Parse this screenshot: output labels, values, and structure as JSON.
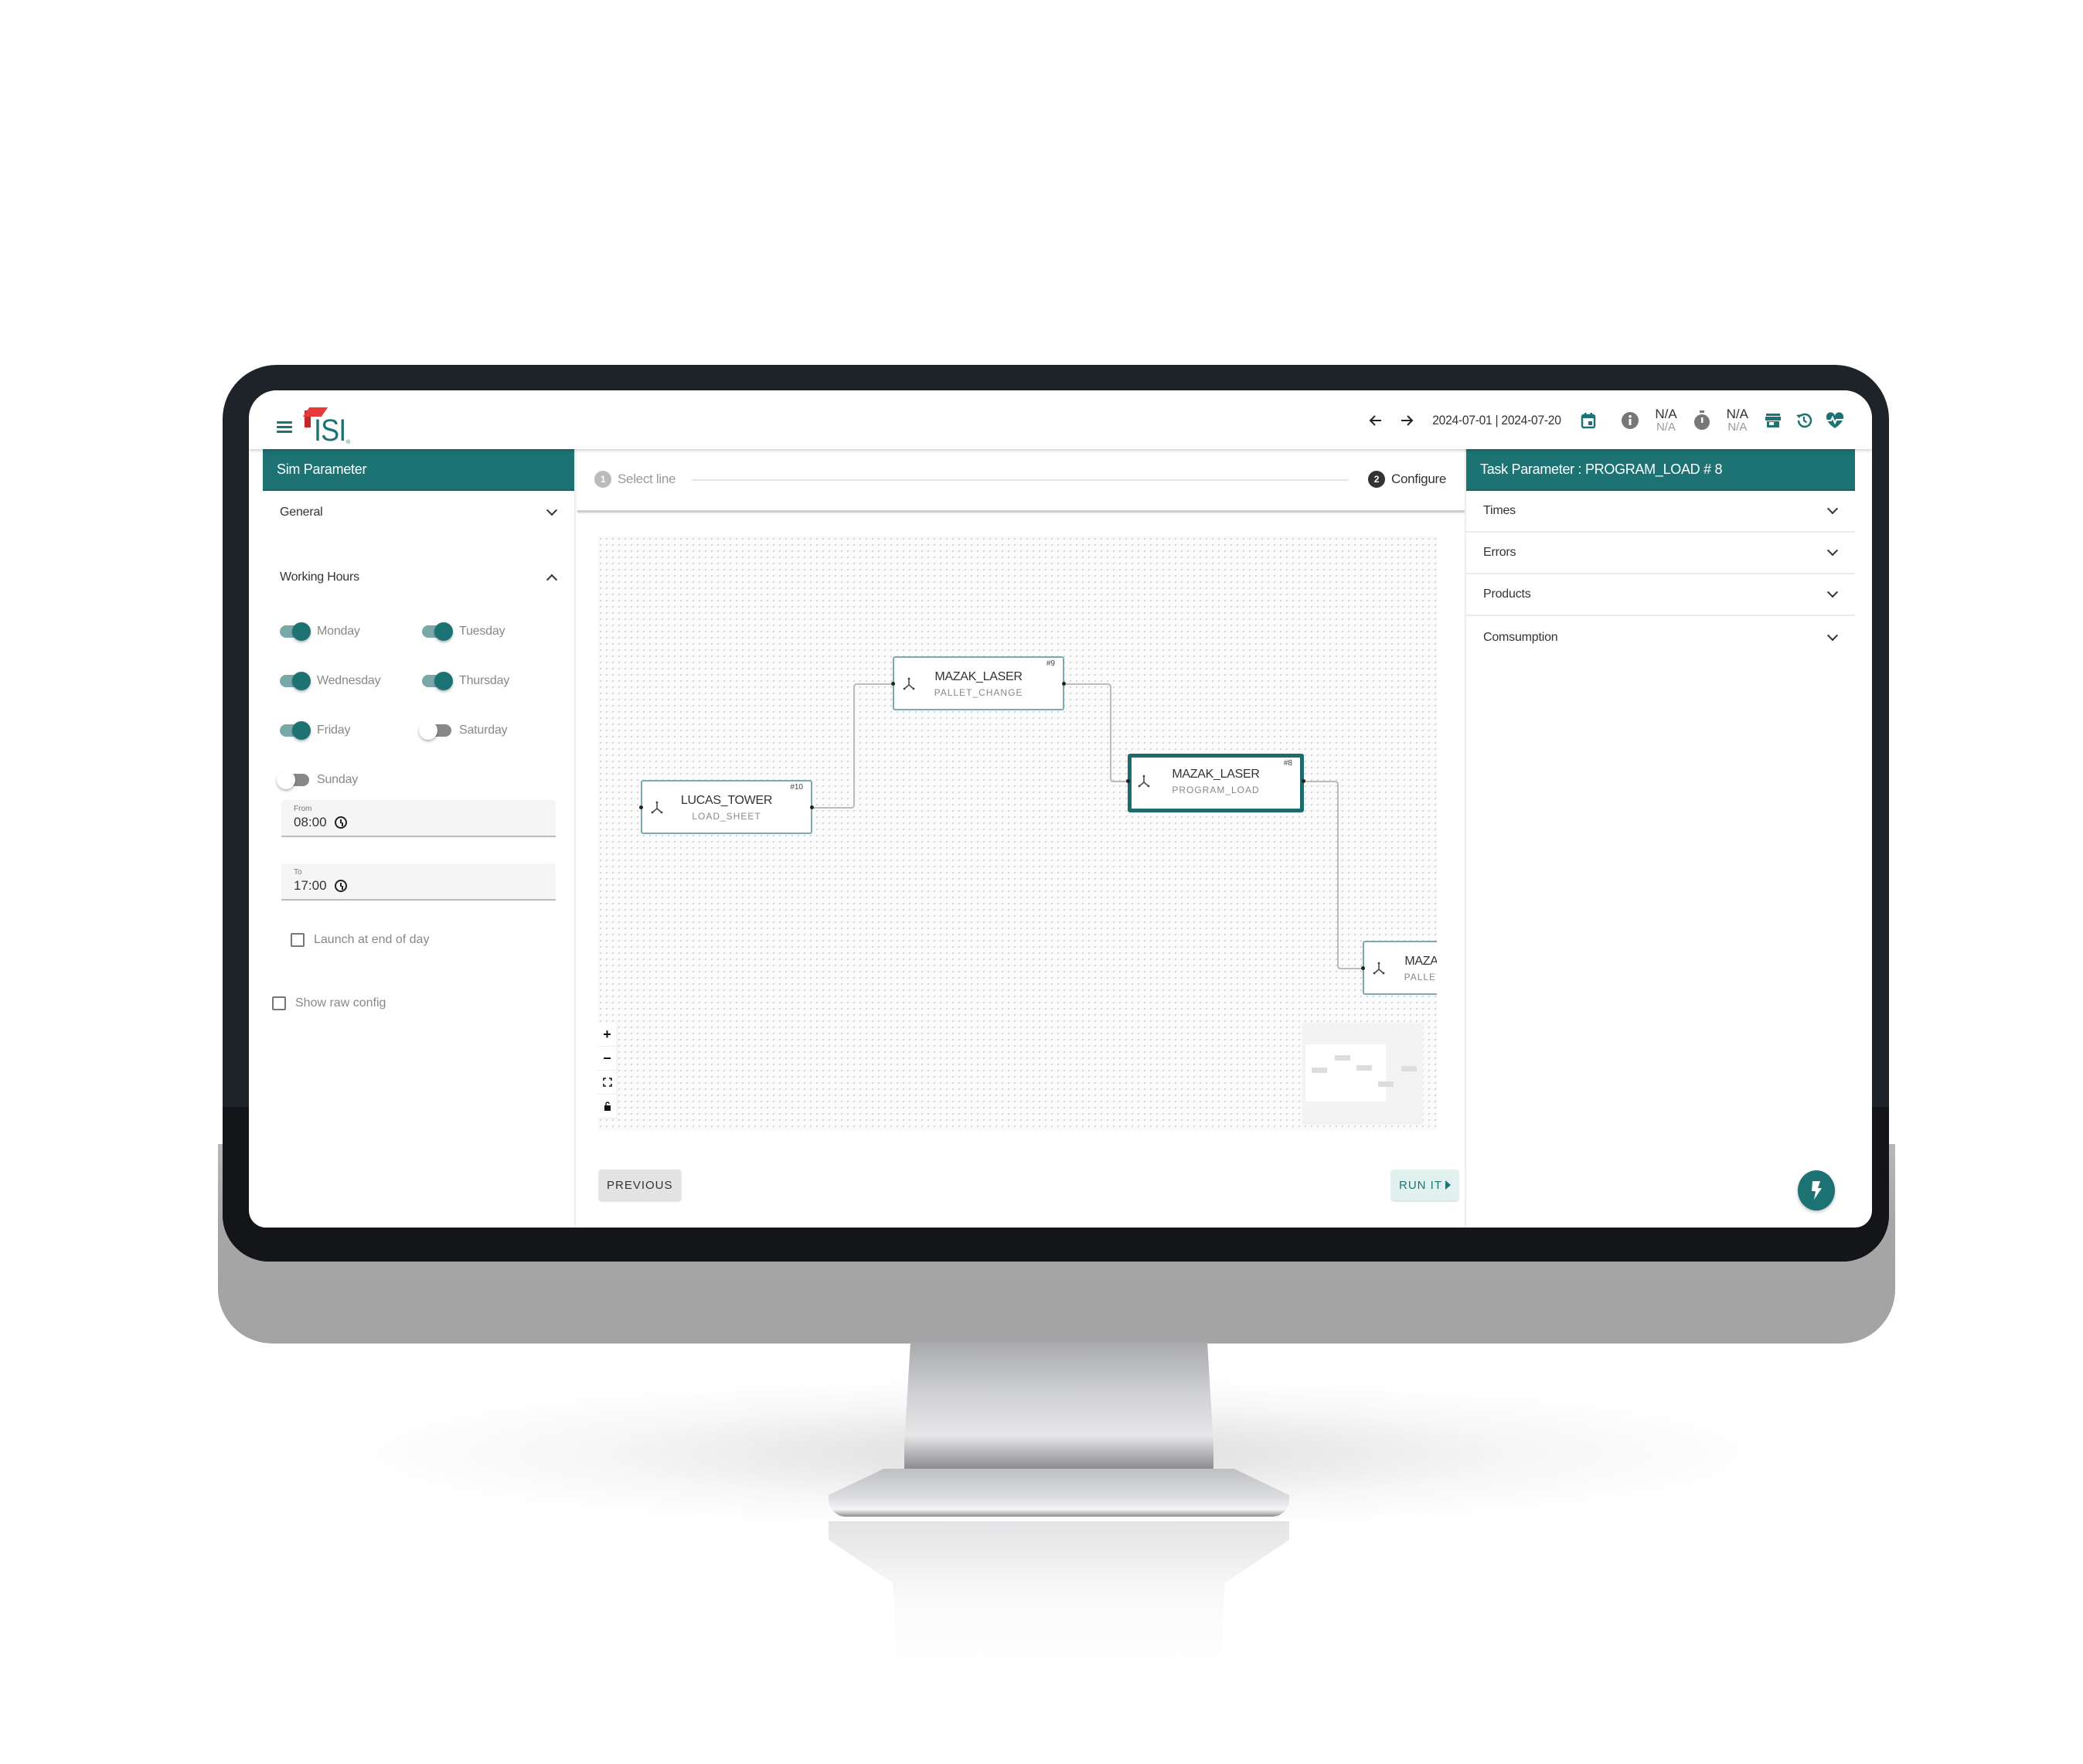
{
  "app": {
    "logo_text": "ISI",
    "logo_reg": "®",
    "brand_color": "#1d7373",
    "logo_accent_color": "#e03030"
  },
  "appbar": {
    "date_range": "2024-07-01 | 2024-07-20",
    "icons": [
      "menu-icon",
      "back-arrow-icon",
      "forward-arrow-icon",
      "calendar-icon",
      "info-icon",
      "stopwatch-icon",
      "store-icon",
      "history-icon",
      "heart-pulse-icon"
    ],
    "stats": [
      {
        "value": "N/A",
        "sub": "N/A"
      },
      {
        "value": "N/A",
        "sub": "N/A"
      }
    ]
  },
  "left_panel": {
    "title": "Sim Parameter",
    "sections": [
      {
        "label": "General",
        "expanded": false
      },
      {
        "label": "Working Hours",
        "expanded": true
      }
    ],
    "days": [
      {
        "label": "Monday",
        "on": true
      },
      {
        "label": "Tuesday",
        "on": true
      },
      {
        "label": "Wednesday",
        "on": true
      },
      {
        "label": "Thursday",
        "on": true
      },
      {
        "label": "Friday",
        "on": true
      },
      {
        "label": "Saturday",
        "on": false
      },
      {
        "label": "Sunday",
        "on": false
      }
    ],
    "from": {
      "label": "From",
      "value": "08:00"
    },
    "to": {
      "label": "To",
      "value": "17:00"
    },
    "launch_end_of_day": {
      "label": "Launch at end of day",
      "checked": false
    },
    "show_raw_config": {
      "label": "Show raw config",
      "checked": false
    }
  },
  "center": {
    "steps": [
      {
        "number": "1",
        "label": "Select line",
        "active": false
      },
      {
        "number": "2",
        "label": "Configure",
        "active": true
      }
    ],
    "nodes": [
      {
        "id": "#10",
        "title": "LUCAS_TOWER",
        "subtitle": "LOAD_SHEET",
        "selected": false
      },
      {
        "id": "#9",
        "title": "MAZAK_LASER",
        "subtitle": "PALLET_CHANGE",
        "selected": false
      },
      {
        "id": "#8",
        "title": "MAZAK_LASER",
        "subtitle": "PROGRAM_LOAD",
        "selected": true
      },
      {
        "id": "",
        "title": "MAZAK_LASER",
        "subtitle": "PALLET_CHANGE",
        "selected": false
      }
    ],
    "zoom_controls": [
      {
        "name": "zoom-in",
        "glyph": "+"
      },
      {
        "name": "zoom-out",
        "glyph": "−"
      },
      {
        "name": "fit-view",
        "glyph": "⛶"
      },
      {
        "name": "lock",
        "glyph": "🔒"
      }
    ],
    "previous_label": "PREVIOUS",
    "run_label": "RUN IT"
  },
  "right_panel": {
    "title": "Task Parameter : PROGRAM_LOAD # 8",
    "sections": [
      {
        "label": "Times"
      },
      {
        "label": "Errors"
      },
      {
        "label": "Products"
      },
      {
        "label": "Comsumption"
      }
    ]
  }
}
